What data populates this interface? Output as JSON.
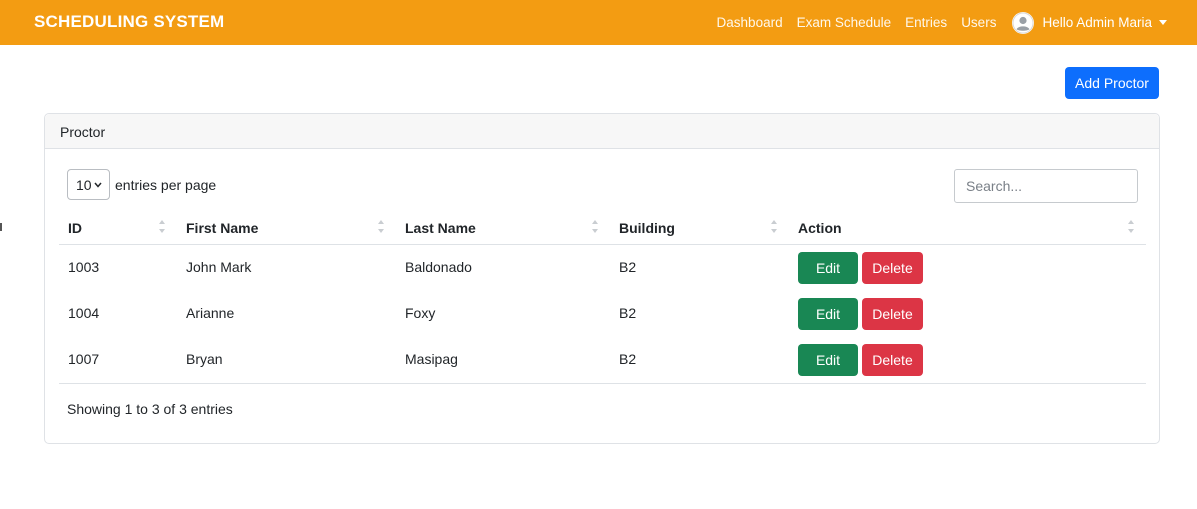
{
  "navbar": {
    "brand": "SCHEDULING SYSTEM",
    "links": [
      "Dashboard",
      "Exam Schedule",
      "Entries",
      "Users"
    ],
    "user_greeting": "Hello Admin Maria",
    "color": "#f39c12"
  },
  "actions": {
    "add_label": "Add Proctor",
    "color": "#0d6efd"
  },
  "card": {
    "title": "Proctor"
  },
  "table_controls": {
    "per_page_value": "10",
    "per_page_label": "entries per page",
    "search_placeholder": "Search..."
  },
  "table": {
    "columns": [
      "ID",
      "First Name",
      "Last Name",
      "Building",
      "Action"
    ],
    "rows": [
      {
        "id": "1003",
        "first_name": "John Mark",
        "last_name": "Baldonado",
        "building": "B2"
      },
      {
        "id": "1004",
        "first_name": "Arianne",
        "last_name": "Foxy",
        "building": "B2"
      },
      {
        "id": "1007",
        "first_name": "Bryan",
        "last_name": "Masipag",
        "building": "B2"
      }
    ],
    "edit_label": "Edit",
    "delete_label": "Delete",
    "edit_color": "#198754",
    "delete_color": "#dc3545"
  },
  "footer_info": "Showing 1 to 3 of 3 entries"
}
